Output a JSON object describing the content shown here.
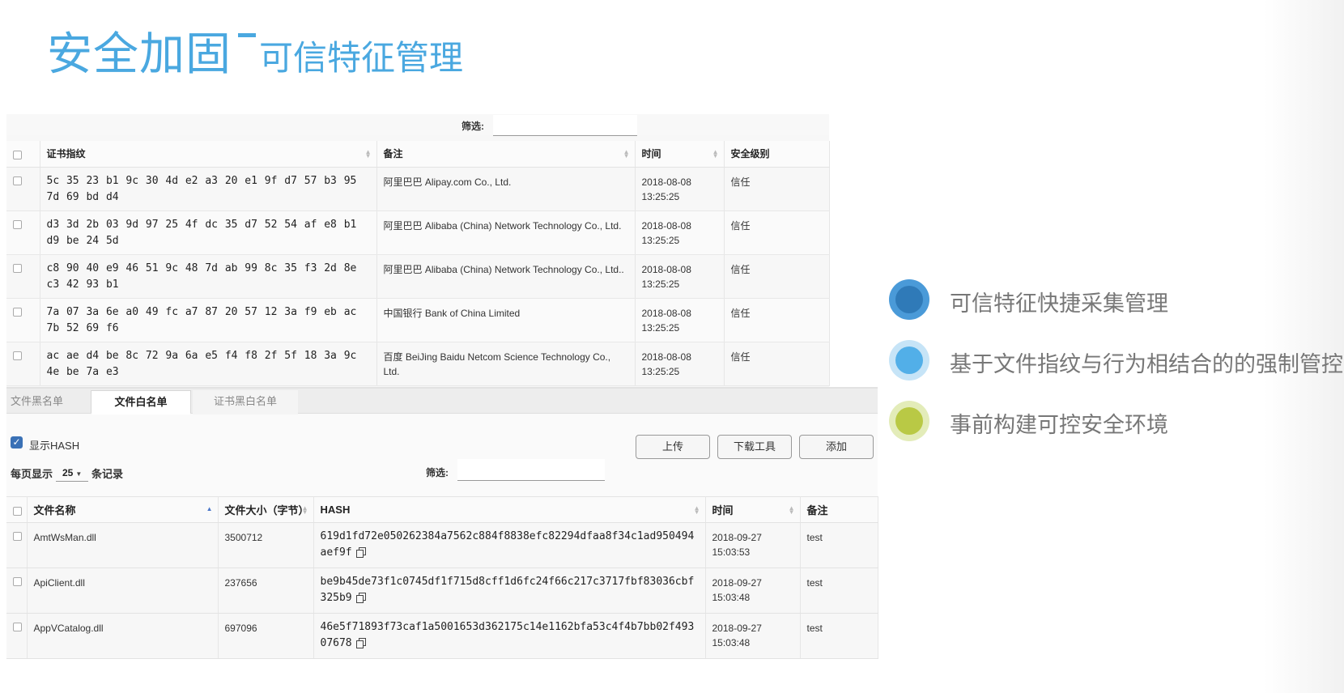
{
  "title": {
    "main": "安全加固",
    "sub": "可信特征管理"
  },
  "cert": {
    "filter_label": "筛选:",
    "filter_value": "",
    "columns": [
      "证书指纹",
      "备注",
      "时间",
      "安全级别"
    ],
    "rows": [
      {
        "fingerprint": "5c 35 23 b1 9c 30 4d e2 a3 20 e1 9f d7 57 b3 95 7d 69 bd d4",
        "note": "阿里巴巴 Alipay.com Co., Ltd.",
        "date": "2018-08-08",
        "time": "13:25:25",
        "level": "信任"
      },
      {
        "fingerprint": "d3 3d 2b 03 9d 97 25 4f dc 35 d7 52 54 af e8 b1 d9 be 24 5d",
        "note": "阿里巴巴 Alibaba (China) Network Technology Co., Ltd.",
        "date": "2018-08-08",
        "time": "13:25:25",
        "level": "信任"
      },
      {
        "fingerprint": "c8 90 40 e9 46 51 9c 48 7d ab 99 8c 35 f3 2d 8e c3 42 93 b1",
        "note": "阿里巴巴 Alibaba (China) Network Technology Co., Ltd..",
        "date": "2018-08-08",
        "time": "13:25:25",
        "level": "信任"
      },
      {
        "fingerprint": "7a 07 3a 6e a0 49 fc a7 87 20 57 12 3a f9 eb ac 7b 52 69 f6",
        "note": "中国银行 Bank of China Limited",
        "date": "2018-08-08",
        "time": "13:25:25",
        "level": "信任"
      },
      {
        "fingerprint": "ac ae d4 be 8c 72 9a 6a e5 f4 f8 2f 5f 18 3a 9c 4e be 7a e3",
        "note": "百度 BeiJing Baidu Netcom Science Technology Co., Ltd.",
        "date": "2018-08-08",
        "time": "13:25:25",
        "level": "信任"
      }
    ]
  },
  "whitelist": {
    "tabs": [
      "文件黑名单",
      "文件白名单",
      "证书黑白名单"
    ],
    "active_tab": "文件白名单",
    "show_hash_label": "显示HASH",
    "show_hash_checked": true,
    "buttons": {
      "upload": "上传",
      "download": "下载工具",
      "add": "添加"
    },
    "per_page_label": "每页显示",
    "per_page_value": "25",
    "records_label": "条记录",
    "filter_label": "筛选:",
    "filter_value": "",
    "columns": [
      "文件名称",
      "文件大小（字节）",
      "HASH",
      "时间",
      "备注"
    ],
    "rows": [
      {
        "name": "AmtWsMan.dll",
        "size": "3500712",
        "hash": "619d1fd72e050262384a7562c884f8838efc82294dfaa8f34c1ad950494aef9f",
        "time": "2018-09-27 15:03:53",
        "note": "test"
      },
      {
        "name": "ApiClient.dll",
        "size": "237656",
        "hash": "be9b45de73f1c0745df1f715d8cff1d6fc24f66c217c3717fbf83036cbf325b9",
        "time": "2018-09-27 15:03:48",
        "note": "test"
      },
      {
        "name": "AppVCatalog.dll",
        "size": "697096",
        "hash": "46e5f71893f73caf1a5001653d362175c14e1162bfa53c4f4b7bb02f49307678",
        "time": "2018-09-27 15:03:48",
        "note": "test"
      }
    ]
  },
  "features": [
    {
      "text": "可信特征快捷采集管理",
      "outer": "#4a9ad8",
      "inner": "#2f7ab8"
    },
    {
      "text": "基于文件指纹与行为相结合的的强制管控",
      "outer": "#c6e4f7",
      "inner": "#52afe8"
    },
    {
      "text": "事前构建可控安全环境",
      "outer": "#e3ecb9",
      "inner": "#b9c945"
    }
  ]
}
